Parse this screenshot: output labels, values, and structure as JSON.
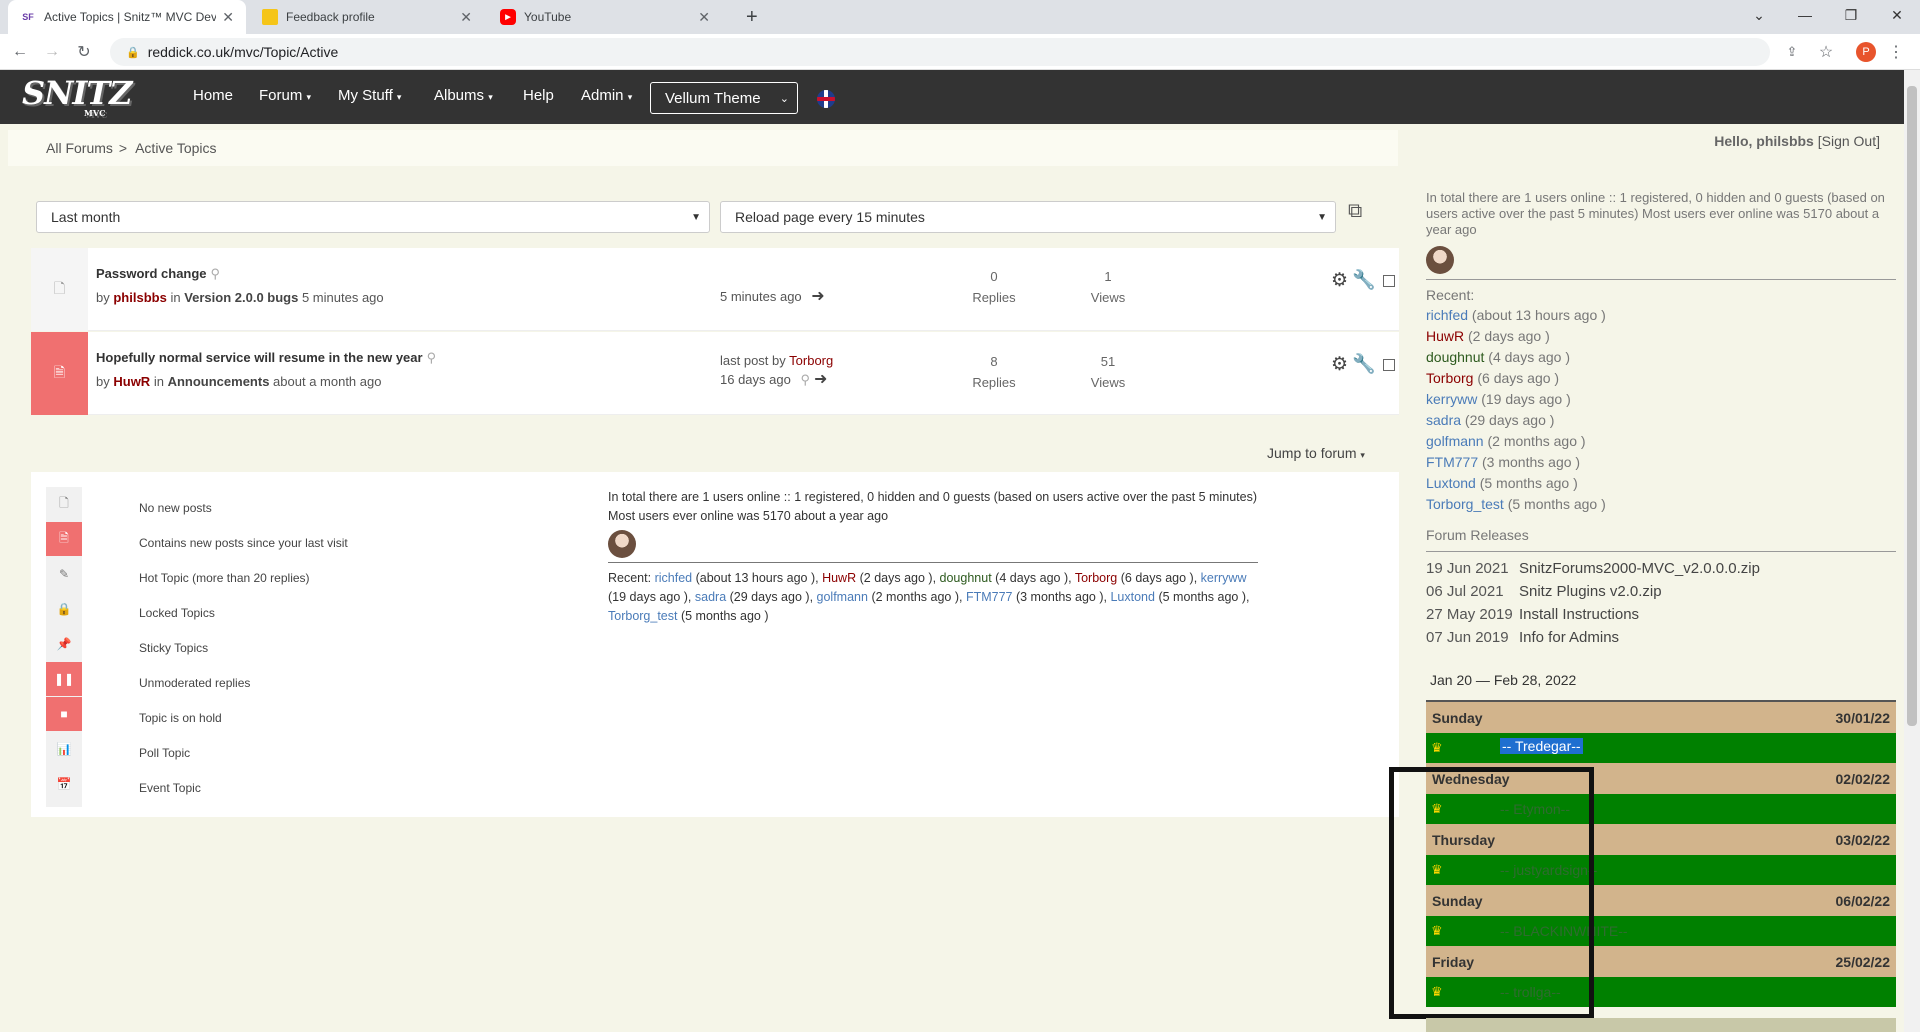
{
  "browser": {
    "tabs": [
      {
        "label": "Active Topics | Snitz™ MVC Dev S",
        "icon": "SF"
      },
      {
        "label": "Feedback profile",
        "icon": "bag-icon"
      },
      {
        "label": "YouTube",
        "icon": "youtube-icon"
      }
    ],
    "url": "reddick.co.uk/mvc/Topic/Active",
    "profile_initial": "P"
  },
  "nav": {
    "logo": "SNITZ",
    "logo_sub": "MVC",
    "items": [
      "Home",
      "Forum",
      "My Stuff",
      "Albums",
      "Help",
      "Admin"
    ],
    "theme": "Vellum Theme"
  },
  "breadcrumb": {
    "root": "All Forums",
    "sep": ">",
    "current": "Active Topics"
  },
  "hello": {
    "greeting": "Hello,",
    "user": "philsbbs",
    "signout": "[Sign Out]"
  },
  "filters": {
    "since": "Last month",
    "reload": "Reload page every 15 minutes"
  },
  "topics": [
    {
      "title": "Password change",
      "by": "by",
      "author": "philsbbs",
      "in": "in",
      "forum": "Version 2.0.0 bugs",
      "when": "5 minutes ago",
      "lastpost_prefix": "",
      "lastpost_user": "",
      "lastpost": "5 minutes ago",
      "replies": "0",
      "replies_label": "Replies",
      "views": "1",
      "views_label": "Views",
      "new": false
    },
    {
      "title": "Hopefully normal service will resume in the new year",
      "by": "by",
      "author": "HuwR",
      "in": "in",
      "forum": "Announcements",
      "when": "about a month ago",
      "lastpost_prefix": "last post by",
      "lastpost_user": "Torborg",
      "lastpost": "16 days ago",
      "replies": "8",
      "replies_label": "Replies",
      "views": "51",
      "views_label": "Views",
      "new": true
    }
  ],
  "jump": "Jump to forum",
  "legend": [
    "No new posts",
    "Contains new posts since your last visit",
    "Hot Topic (more than 20 replies)",
    "Locked Topics",
    "Sticky Topics",
    "Unmoderated replies",
    "Topic is on hold",
    "Poll Topic",
    "Event Topic"
  ],
  "online": {
    "summary": "In total there are 1 users online :: 1 registered, 0 hidden and 0 guests (based on users active over the past 5 minutes) Most users ever online was 5170 about a year ago",
    "recent_label": "Recent:",
    "recent": [
      {
        "user": "richfed",
        "ago": "(about 13 hours ago )"
      },
      {
        "user": "HuwR",
        "ago": "(2 days ago )"
      },
      {
        "user": "doughnut",
        "ago": "(4 days ago )"
      },
      {
        "user": "Torborg",
        "ago": "(6 days ago )"
      },
      {
        "user": "kerryww",
        "ago": "(19 days ago )"
      },
      {
        "user": "sadra",
        "ago": "(29 days ago )"
      },
      {
        "user": "golfmann",
        "ago": "(2 months ago )"
      },
      {
        "user": "FTM777",
        "ago": "(3 months ago )"
      },
      {
        "user": "Luxtond",
        "ago": "(5 months ago )"
      },
      {
        "user": "Torborg_test",
        "ago": "(5 months ago )"
      }
    ]
  },
  "releases": {
    "title": "Forum Releases",
    "items": [
      {
        "date": "19 Jun 2021",
        "name": "SnitzForums2000-MVC_v2.0.0.0.zip"
      },
      {
        "date": "06 Jul 2021",
        "name": "Snitz Plugins v2.0.zip"
      },
      {
        "date": "27 May 2019",
        "name": "Install Instructions"
      },
      {
        "date": "07 Jun 2019",
        "name": "Info for Admins"
      }
    ]
  },
  "calendar": {
    "range": "Jan 20 — Feb 28, 2022",
    "days": [
      {
        "day": "Sunday",
        "date": "30/01/22",
        "event": "-- Tredegar--"
      },
      {
        "day": "Wednesday",
        "date": "02/02/22",
        "event": "-- Etymon--"
      },
      {
        "day": "Thursday",
        "date": "03/02/22",
        "event": "-- justyardsign--"
      },
      {
        "day": "Sunday",
        "date": "06/02/22",
        "event": "-- BLACKINWHITE--"
      },
      {
        "day": "Friday",
        "date": "25/02/22",
        "event": "-- trollga--"
      }
    ]
  },
  "colors": {
    "nav_bg": "#333333",
    "new_topic": "#f07070",
    "cal_day": "#d2b48c",
    "cal_event": "#008000"
  }
}
